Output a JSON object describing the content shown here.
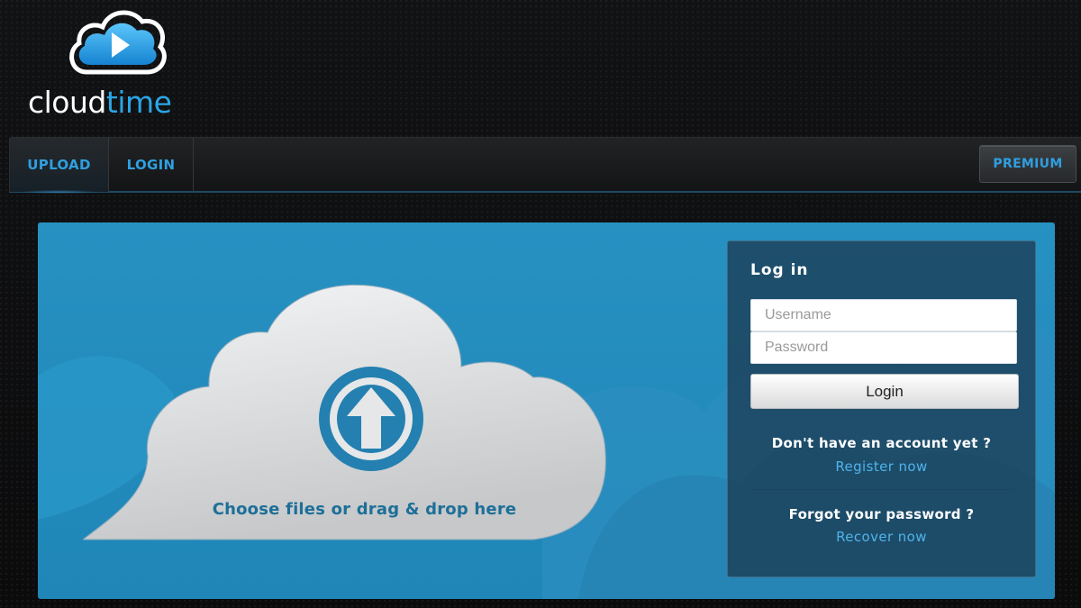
{
  "logo": {
    "word1": "cloud",
    "word2": "time",
    "icon": "cloud-play-icon",
    "colors": {
      "primary": "#2aa6e6",
      "text": "#ffffff"
    }
  },
  "nav": {
    "tabs": [
      {
        "label": "UPLOAD",
        "active": true
      },
      {
        "label": "LOGIN",
        "active": false
      }
    ],
    "premium_label": "PREMIUM"
  },
  "upload": {
    "icon": "upload-arrow-icon",
    "text": "Choose files or drag & drop here"
  },
  "login": {
    "title": "Log in",
    "username_placeholder": "Username",
    "password_placeholder": "Password",
    "button_label": "Login",
    "register_prompt": "Don't have an account yet ?",
    "register_link": "Register now",
    "forgot_prompt": "Forgot your password ?",
    "recover_link": "Recover now"
  },
  "colors": {
    "panel_bg": "#2791c2",
    "accent": "#2f9fe0",
    "link": "#4fb3ea",
    "page_bg": "#0d0d0e"
  }
}
